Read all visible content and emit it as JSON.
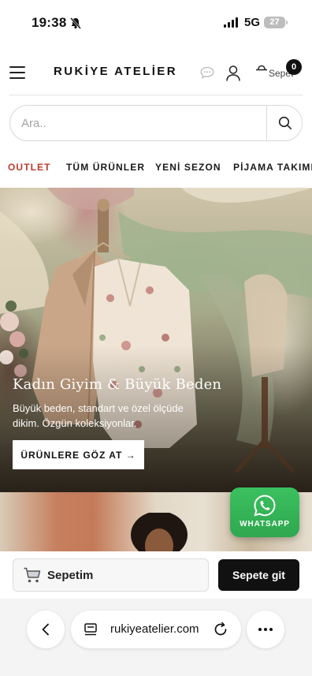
{
  "status_bar": {
    "time": "19:38",
    "network": "5G",
    "battery": "27"
  },
  "header": {
    "brand": "RUKİYE ATELİER ...",
    "cart_label": "Sepet",
    "cart_count": "0"
  },
  "search": {
    "placeholder": "Ara.."
  },
  "categories": [
    {
      "label": "OUTLET",
      "active": true
    },
    {
      "label": "TÜM ÜRÜNLER",
      "active": false
    },
    {
      "label": "YENİ SEZON",
      "active": false
    },
    {
      "label": "PİJAMA TAKIMI",
      "active": false
    }
  ],
  "hero": {
    "title": "Kadın Giyim & Büyük Beden",
    "subtitle": "Büyük beden, standart ve özel ölçüde dikim. Özgün koleksiyonlar.",
    "cta": "ÜRÜNLERE GÖZ AT →"
  },
  "whatsapp": {
    "label": "WHATSAPP",
    "color": "#34b356"
  },
  "cart_bar": {
    "my_cart": "Sepetim",
    "go_to_cart": "Sepete git"
  },
  "browser": {
    "url": "rukiyeatelier.com"
  },
  "colors": {
    "accent": "#c0392b",
    "dark": "#111111"
  }
}
